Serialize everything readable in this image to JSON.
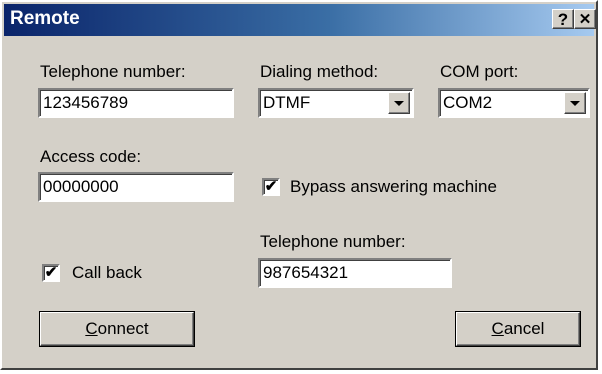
{
  "window": {
    "title": "Remote",
    "help_glyph": "?",
    "close_glyph": "✕"
  },
  "dialing": {
    "telephone_label": "Telephone number:",
    "telephone_value": "123456789",
    "method_label": "Dialing method:",
    "method_value": "DTMF",
    "com_label": "COM port:",
    "com_value": "COM2"
  },
  "access": {
    "label": "Access code:",
    "value": "00000000"
  },
  "options": {
    "bypass_label": "Bypass answering machine",
    "bypass_checked": true,
    "callback_label": "Call back",
    "callback_checked": true,
    "callback_number_label": "Telephone number:",
    "callback_number_value": "987654321"
  },
  "buttons": {
    "connect_accel": "C",
    "connect_rest": "onnect",
    "cancel_accel": "C",
    "cancel_rest": "ancel"
  },
  "check_glyph": "✔"
}
